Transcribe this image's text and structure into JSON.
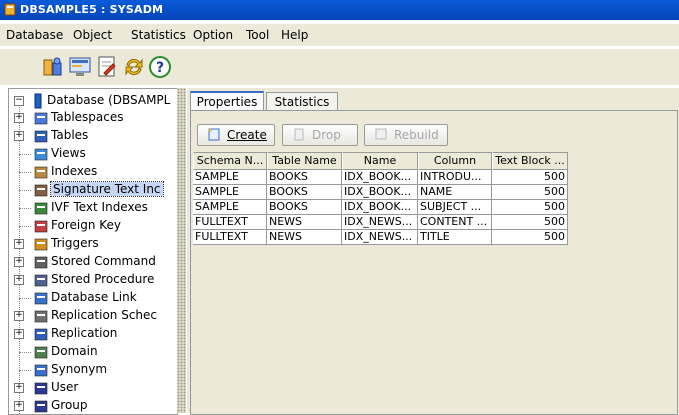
{
  "window": {
    "title": "DBSAMPLE5 : SYSADM"
  },
  "menu": {
    "items": [
      "Database",
      "Object",
      "Statistics",
      "Option",
      "Tool",
      "Help"
    ]
  },
  "toolbar": {
    "icons": [
      "users-icon",
      "monitor-icon",
      "edit-icon",
      "refresh-icon",
      "help-icon"
    ]
  },
  "tree": {
    "root": "Database (DBSAMPL",
    "items": [
      {
        "label": "Tablespaces",
        "icon": "tablespaces-icon",
        "expandable": true
      },
      {
        "label": "Tables",
        "icon": "tables-icon",
        "expandable": true
      },
      {
        "label": "Views",
        "icon": "views-icon",
        "expandable": false
      },
      {
        "label": "Indexes",
        "icon": "indexes-icon",
        "expandable": false
      },
      {
        "label": "Signature Text Inc",
        "icon": "signature-index-icon",
        "expandable": false,
        "selected": true
      },
      {
        "label": "IVF Text Indexes",
        "icon": "ivf-index-icon",
        "expandable": false
      },
      {
        "label": "Foreign Key",
        "icon": "foreign-key-icon",
        "expandable": false
      },
      {
        "label": "Triggers",
        "icon": "triggers-icon",
        "expandable": true
      },
      {
        "label": "Stored Command",
        "icon": "stored-command-icon",
        "expandable": true
      },
      {
        "label": "Stored Procedure",
        "icon": "stored-procedure-icon",
        "expandable": true
      },
      {
        "label": "Database Link",
        "icon": "database-link-icon",
        "expandable": false
      },
      {
        "label": "Replication Schec",
        "icon": "replication-schedule-icon",
        "expandable": true
      },
      {
        "label": "Replication",
        "icon": "replication-icon",
        "expandable": true
      },
      {
        "label": "Domain",
        "icon": "domain-icon",
        "expandable": false
      },
      {
        "label": "Synonym",
        "icon": "synonym-icon",
        "expandable": false
      },
      {
        "label": "User",
        "icon": "user-icon",
        "expandable": true
      },
      {
        "label": "Group",
        "icon": "group-icon",
        "expandable": true
      }
    ]
  },
  "tabs": [
    {
      "label": "Properties",
      "active": true
    },
    {
      "label": "Statistics",
      "active": false
    }
  ],
  "buttons": {
    "create": "Create",
    "drop": "Drop",
    "rebuild": "Rebuild"
  },
  "table": {
    "columns": [
      "Schema N...",
      "Table Name",
      "Name",
      "Column",
      "Text Block ..."
    ],
    "rows": [
      [
        "SAMPLE",
        "BOOKS",
        "IDX_BOOK...",
        "INTRODU...",
        "500"
      ],
      [
        "SAMPLE",
        "BOOKS",
        "IDX_BOOK...",
        "NAME",
        "500"
      ],
      [
        "SAMPLE",
        "BOOKS",
        "IDX_BOOK...",
        "SUBJECT ...",
        "500"
      ],
      [
        "FULLTEXT",
        "NEWS",
        "IDX_NEWS...",
        "CONTENT ...",
        "500"
      ],
      [
        "FULLTEXT",
        "NEWS",
        "IDX_NEWS...",
        "TITLE",
        "500"
      ]
    ]
  },
  "colors": {
    "titlebar": "#0a5bd8",
    "chrome": "#ece9d8",
    "selection": "#c6d7f5"
  }
}
